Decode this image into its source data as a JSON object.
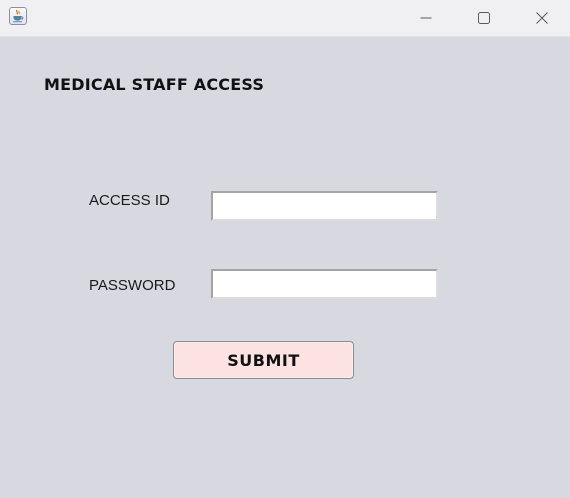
{
  "window": {
    "app_icon": "java-cup-icon",
    "controls": {
      "minimize_icon": "minimize-icon",
      "maximize_icon": "maximize-icon",
      "close_icon": "close-icon"
    }
  },
  "form": {
    "title": "MEDICAL STAFF ACCESS",
    "access_id": {
      "label": "ACCESS ID",
      "value": "",
      "placeholder": ""
    },
    "password": {
      "label": "PASSWORD",
      "value": "",
      "placeholder": ""
    },
    "submit_label": "SUBMIT"
  },
  "colors": {
    "background": "#d7d8e0",
    "titlebar": "#f0f0f2",
    "submit_background": "#fde2e2"
  }
}
